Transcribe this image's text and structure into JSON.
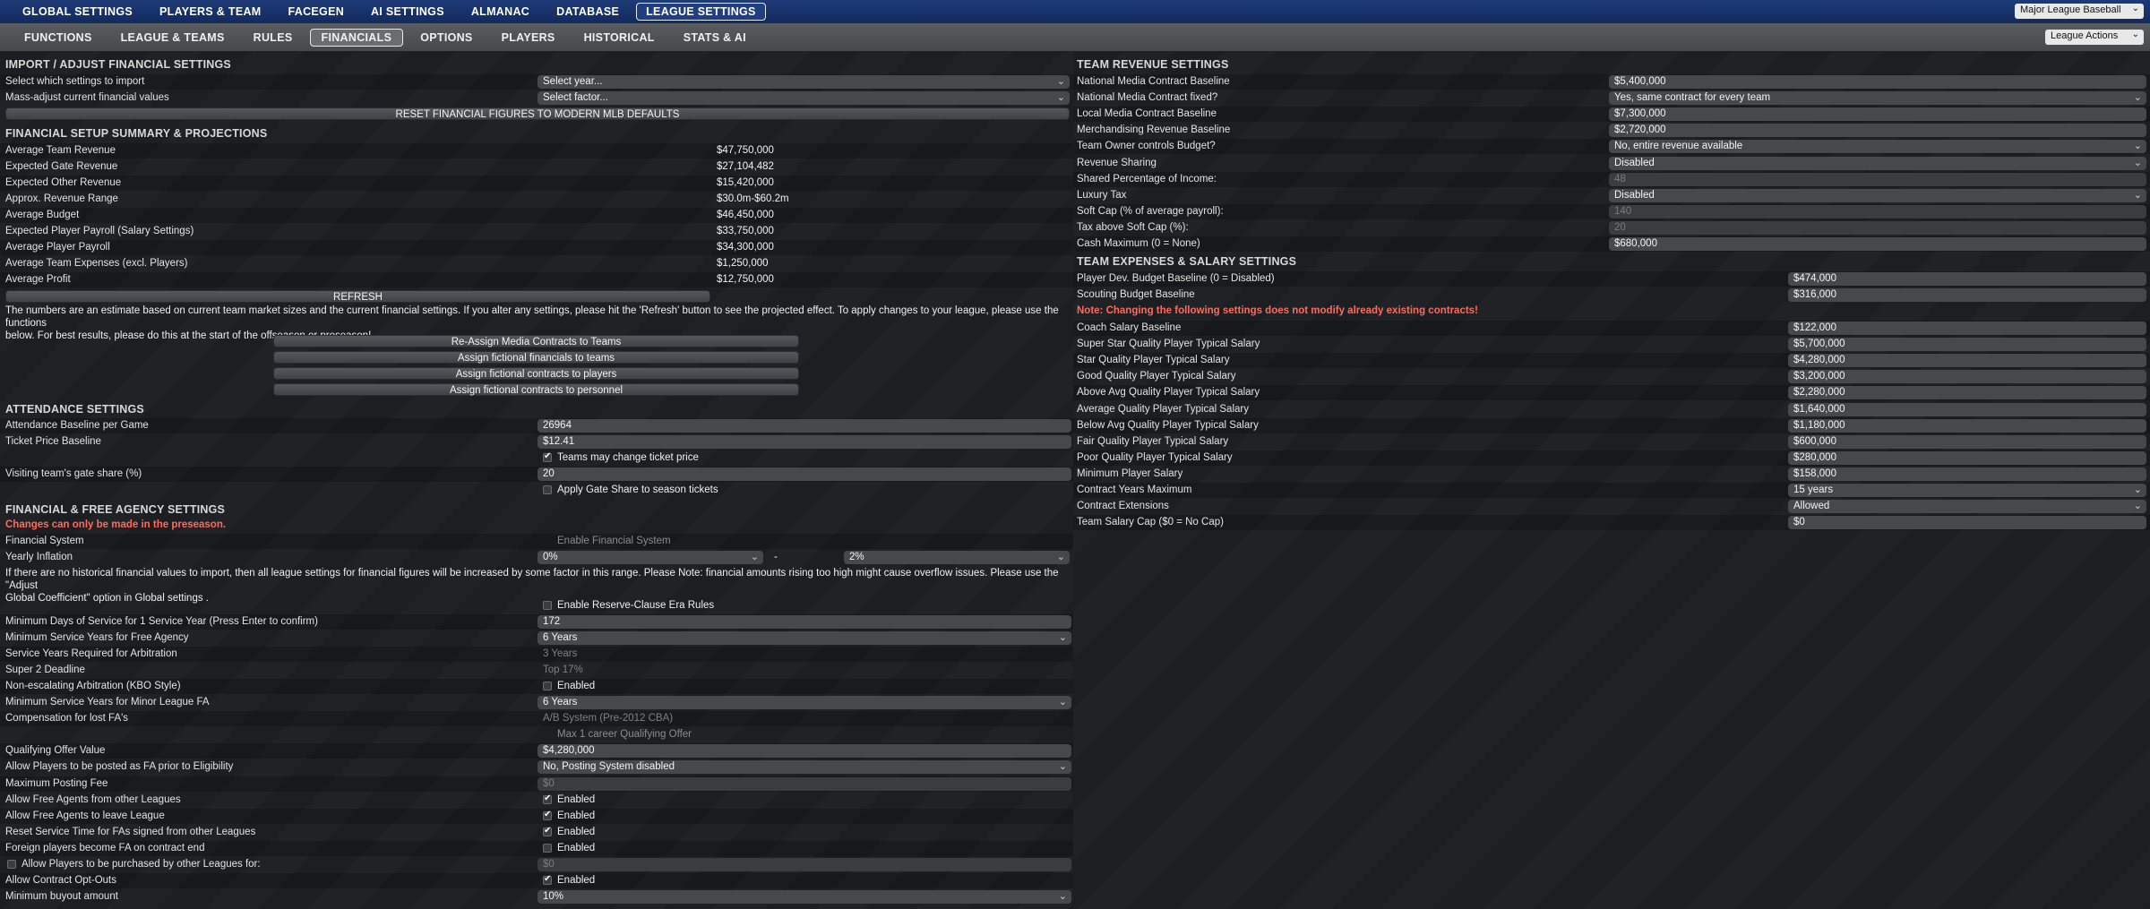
{
  "topnav": {
    "tabs": [
      "GLOBAL SETTINGS",
      "PLAYERS & TEAM",
      "FACEGEN",
      "AI SETTINGS",
      "ALMANAC",
      "DATABASE",
      "LEAGUE SETTINGS"
    ],
    "league_select": "Major League Baseball"
  },
  "subnav": {
    "tabs": [
      "FUNCTIONS",
      "LEAGUE & TEAMS",
      "RULES",
      "FINANCIALS",
      "OPTIONS",
      "PLAYERS",
      "HISTORICAL",
      "STATS & AI"
    ],
    "league_actions": "League Actions"
  },
  "import": {
    "title": "IMPORT / ADJUST FINANCIAL SETTINGS",
    "select_label": "Select which settings to import",
    "select_value": "Select year...",
    "mass_label": "Mass-adjust current financial values",
    "mass_value": "Select factor...",
    "reset_button": "RESET FINANCIAL FIGURES TO MODERN MLB DEFAULTS"
  },
  "summary": {
    "title": "FINANCIAL SETUP SUMMARY & PROJECTIONS",
    "rows": [
      {
        "label": "Average Team Revenue",
        "value": "$47,750,000"
      },
      {
        "label": "Expected Gate Revenue",
        "value": "$27,104,482"
      },
      {
        "label": "Expected Other Revenue",
        "value": "$15,420,000"
      },
      {
        "label": "Approx. Revenue Range",
        "value": "$30.0m-$60.2m"
      },
      {
        "label": "Average Budget",
        "value": "$46,450,000"
      },
      {
        "label": "Expected Player Payroll (Salary Settings)",
        "value": "$33,750,000"
      },
      {
        "label": "Average Player Payroll",
        "value": "$34,300,000"
      },
      {
        "label": "Average Team Expenses (excl. Players)",
        "value": "$1,250,000"
      },
      {
        "label": "Average Profit",
        "value": "$12,750,000"
      }
    ],
    "refresh_button": "REFRESH",
    "note_line1": "The numbers are an estimate based on current team market sizes and the current financial settings. If you alter any settings, please hit the 'Refresh' button to see the projected effect. To apply changes to your league, please use the functions",
    "note_line2": "below. For best results, please do this at the start of the offseason or preseason!",
    "actions": [
      "Re-Assign Media Contracts to Teams",
      "Assign fictional financials to teams",
      "Assign fictional contracts to players",
      "Assign fictional contracts to personnel"
    ]
  },
  "attendance": {
    "title": "ATTENDANCE SETTINGS",
    "baseline_label": "Attendance Baseline per Game",
    "baseline_value": "26964",
    "ticket_label": "Ticket Price Baseline",
    "ticket_value": "$12.41",
    "teams_change_label": "Teams may change ticket price",
    "visiting_label": "Visiting team's gate share (%)",
    "visiting_value": "20",
    "apply_gate_label": "Apply Gate Share to season tickets"
  },
  "fa": {
    "title": "FINANCIAL & FREE AGENCY SETTINGS",
    "warning": "Changes can only be made in the preseason.",
    "financial_system_label": "Financial System",
    "financial_system_value": "Enable Financial System",
    "inflation_label": "Yearly Inflation",
    "inflation_min": "0%",
    "inflation_sep": "-",
    "inflation_max": "2%",
    "note_line1": "If there are no historical financial values to import, then all league settings for financial figures will be increased by some factor in this range. Please Note: financial amounts rising too high might cause overflow issues. Please use the \"Adjust",
    "note_line2": "Global Coefficient\" option in Global settings .",
    "reserve_label": "Enable Reserve-Clause Era Rules",
    "rows": [
      {
        "label": "Minimum Days of Service for 1 Service Year (Press Enter to confirm)",
        "value": "172"
      },
      {
        "label": "Minimum Service Years for Free Agency",
        "value": "6 Years"
      },
      {
        "label": "Service Years Required for Arbitration",
        "value": "3 Years"
      },
      {
        "label": "Super 2 Deadline",
        "value": "Top 17%"
      },
      {
        "label": "Non-escalating Arbitration (KBO Style)",
        "value": "Enabled"
      },
      {
        "label": "Minimum Service Years for Minor League FA",
        "value": "6 Years"
      },
      {
        "label": "Compensation for lost FA's",
        "value": "A/B System (Pre-2012 CBA)"
      },
      {
        "label": "",
        "value": "Max 1 career Qualifying Offer"
      },
      {
        "label": "Qualifying Offer Value",
        "value": "$4,280,000"
      },
      {
        "label": "Allow Players to be posted as FA prior to Eligibility",
        "value": "No, Posting System disabled"
      },
      {
        "label": "Maximum Posting Fee",
        "value": "$0"
      },
      {
        "label": "Allow Free Agents from other Leagues",
        "value": "Enabled"
      },
      {
        "label": "Allow Free Agents to leave League",
        "value": "Enabled"
      },
      {
        "label": "Reset Service Time for FAs signed from other Leagues",
        "value": "Enabled"
      },
      {
        "label": "Foreign players become FA on contract end",
        "value": "Enabled"
      },
      {
        "label": "Allow Players to be purchased by other Leagues for:",
        "value": "$0"
      },
      {
        "label": "Allow Contract Opt-Outs",
        "value": "Enabled"
      },
      {
        "label": "Minimum buyout amount",
        "value": "10%"
      }
    ]
  },
  "revenue": {
    "title": "TEAM REVENUE SETTINGS",
    "rows": [
      {
        "label": "National Media Contract Baseline",
        "value": "$5,400,000"
      },
      {
        "label": "National Media Contract fixed?",
        "value": "Yes, same contract for every team"
      },
      {
        "label": "Local Media Contract Baseline",
        "value": "$7,300,000"
      },
      {
        "label": "Merchandising Revenue Baseline",
        "value": "$2,720,000"
      },
      {
        "label": "Team Owner controls Budget?",
        "value": "No, entire revenue available"
      },
      {
        "label": "Revenue Sharing",
        "value": "Disabled"
      },
      {
        "label": "Shared Percentage of Income:",
        "value": "48"
      },
      {
        "label": "Luxury Tax",
        "value": "Disabled"
      },
      {
        "label": "Soft Cap (% of average payroll):",
        "value": "140"
      },
      {
        "label": "Tax above Soft Cap (%):",
        "value": "20"
      },
      {
        "label": "Cash Maximum (0 = None)",
        "value": "$680,000"
      }
    ]
  },
  "expenses": {
    "title": "TEAM EXPENSES & SALARY SETTINGS",
    "note": "Note: Changing the following settings does not modify already existing contracts!",
    "rows_top": [
      {
        "label": "Player Dev. Budget Baseline (0 = Disabled)",
        "value": "$474,000"
      },
      {
        "label": "Scouting Budget Baseline",
        "value": "$316,000"
      }
    ],
    "rows": [
      {
        "label": "Coach Salary Baseline",
        "value": "$122,000"
      },
      {
        "label": "Super Star Quality Player Typical Salary",
        "value": "$5,700,000"
      },
      {
        "label": "Star Quality Player Typical Salary",
        "value": "$4,280,000"
      },
      {
        "label": "Good Quality Player Typical Salary",
        "value": "$3,200,000"
      },
      {
        "label": "Above Avg Quality Player Typical Salary",
        "value": "$2,280,000"
      },
      {
        "label": "Average Quality Player Typical Salary",
        "value": "$1,640,000"
      },
      {
        "label": "Below Avg Quality Player Typical Salary",
        "value": "$1,180,000"
      },
      {
        "label": "Fair Quality Player Typical Salary",
        "value": "$600,000"
      },
      {
        "label": "Poor Quality Player Typical Salary",
        "value": "$280,000"
      },
      {
        "label": "Minimum Player Salary",
        "value": "$158,000"
      },
      {
        "label": "Contract Years Maximum",
        "value": "15 years"
      },
      {
        "label": "Contract Extensions",
        "value": "Allowed"
      },
      {
        "label": "Team Salary Cap ($0 = No Cap)",
        "value": "$0"
      }
    ]
  }
}
